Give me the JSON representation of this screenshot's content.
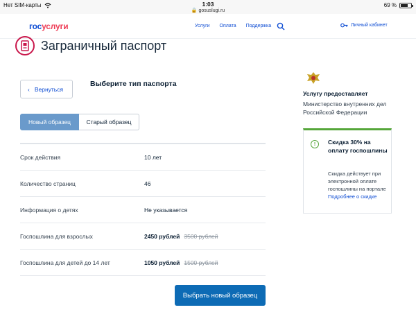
{
  "status_bar": {
    "carrier": "Нет SIM-карты",
    "time": "1:03",
    "url": "gosuslugi.ru",
    "battery": "69 %",
    "battery_level": 0.69
  },
  "header": {
    "logo_part1": "гос",
    "logo_part2": "услуги",
    "nav": [
      "Услуги",
      "Оплата",
      "Поддержка"
    ],
    "cabinet": "Личный кабинет"
  },
  "page": {
    "title": "Заграничный паспорт",
    "back_label": "Вернуться",
    "choose_type_title": "Выберите тип паспорта",
    "tabs": [
      "Новый образец",
      "Старый образец"
    ],
    "rows": [
      {
        "label": "Срок действия",
        "value": "10 лет"
      },
      {
        "label": "Количество страниц",
        "value": "46"
      },
      {
        "label": "Информация о детях",
        "value": "Не указывается"
      },
      {
        "label": "Госпошлина для взрослых",
        "price": "2450 рублей",
        "old_price": "3500 рублей"
      },
      {
        "label": "Госпошлина для детей до 14 лет",
        "price": "1050 рублей",
        "old_price": "1500 рублей"
      }
    ],
    "choose_button": "Выбрать новый образец"
  },
  "sidebar": {
    "provider_label": "Услугу предоставляет",
    "provider_org": "Министерство внутренних дел Российской Федерации",
    "discount_icon": "!",
    "discount_title": "Скидка 30% на оплату госпошлины",
    "discount_text": "Скидка действует при электронной оплате госпошлины на портале",
    "discount_link": "Подробнее о скидке"
  },
  "colors": {
    "brand_blue": "#0d4cd3",
    "brand_red": "#ee3f58",
    "active_tab": "#6a9acb",
    "primary_button": "#0d6bb5",
    "discount_green": "#55a63a"
  }
}
